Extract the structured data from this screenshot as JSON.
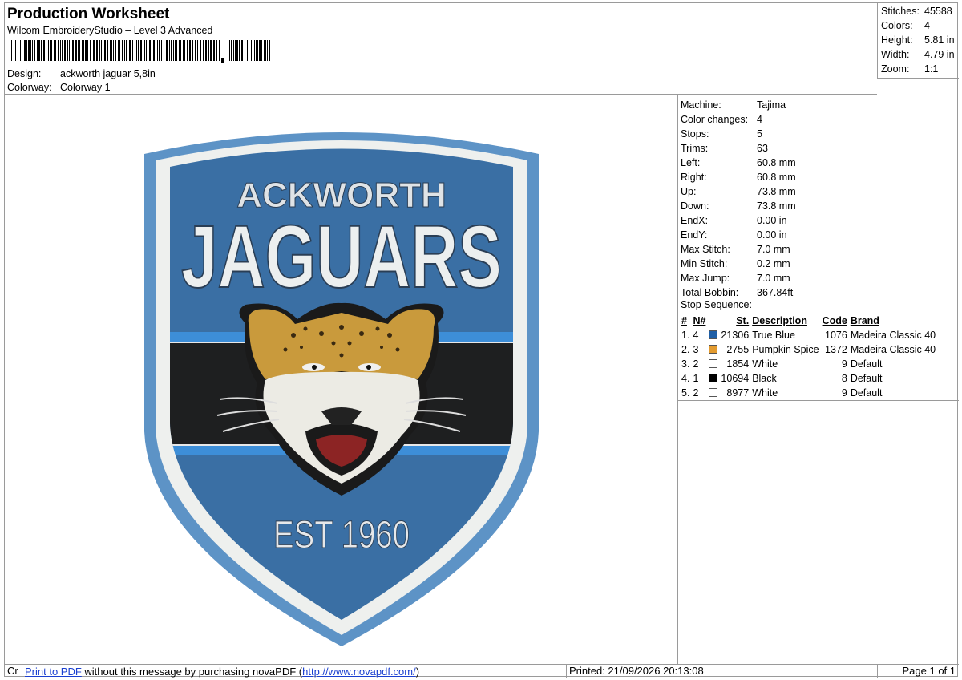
{
  "header": {
    "title": "Production Worksheet",
    "software": "Wilcom EmbroideryStudio – Level 3 Advanced",
    "design_label": "Design:",
    "design_value": "ackworth jaguar 5,8in",
    "colorway_label": "Colorway:",
    "colorway_value": "Colorway 1"
  },
  "summary": {
    "stitches_label": "Stitches:",
    "stitches": "45588",
    "colors_label": "Colors:",
    "colors": "4",
    "height_label": "Height:",
    "height": "5.81 in",
    "width_label": "Width:",
    "width": "4.79 in",
    "zoom_label": "Zoom:",
    "zoom": "1:1"
  },
  "specs": [
    {
      "k": "Machine:",
      "v": "Tajima"
    },
    {
      "k": "Color changes:",
      "v": "4"
    },
    {
      "k": "Stops:",
      "v": "5"
    },
    {
      "k": "Trims:",
      "v": "63"
    },
    {
      "k": "Left:",
      "v": "60.8 mm"
    },
    {
      "k": "Right:",
      "v": "60.8 mm"
    },
    {
      "k": "Up:",
      "v": "73.8 mm"
    },
    {
      "k": "Down:",
      "v": "73.8 mm"
    },
    {
      "k": "EndX:",
      "v": "0.00 in"
    },
    {
      "k": "EndY:",
      "v": "0.00 in"
    },
    {
      "k": "Max Stitch:",
      "v": "7.0 mm"
    },
    {
      "k": "Min Stitch:",
      "v": "0.2 mm"
    },
    {
      "k": "Max Jump:",
      "v": "7.0 mm"
    },
    {
      "k": "Total Bobbin:",
      "v": "367.84ft"
    }
  ],
  "stop_sequence": {
    "title": "Stop Sequence:",
    "headers": {
      "num": "#",
      "n": "N#",
      "st": "St.",
      "desc": "Description",
      "code": "Code",
      "brand": "Brand"
    },
    "rows": [
      {
        "num": "1.",
        "n": "4",
        "color": "#1f5fa6",
        "st": "21306",
        "desc": "True Blue",
        "code": "1076",
        "brand": "Madeira Classic 40"
      },
      {
        "num": "2.",
        "n": "3",
        "color": "#e39b2f",
        "st": "2755",
        "desc": "Pumpkin Spice",
        "code": "1372",
        "brand": "Madeira Classic 40"
      },
      {
        "num": "3.",
        "n": "2",
        "color": "#ffffff",
        "st": "1854",
        "desc": "White",
        "code": "9",
        "brand": "Default"
      },
      {
        "num": "4.",
        "n": "1",
        "color": "#000000",
        "st": "10694",
        "desc": "Black",
        "code": "8",
        "brand": "Default"
      },
      {
        "num": "5.",
        "n": "2",
        "color": "#ffffff",
        "st": "8977",
        "desc": "White",
        "code": "9",
        "brand": "Default"
      }
    ]
  },
  "patch": {
    "line1": "ACKWORTH",
    "line2": "JAGUARS",
    "line3": "EST 1960"
  },
  "footer": {
    "cr": "Cr",
    "link1": "Print to PDF",
    "msg": " without this message by purchasing novaPDF (",
    "link2": "http://www.novapdf.com/",
    "msg_end": ")",
    "printed": "Printed: 21/09/2026 20:13:08",
    "page": "Page 1 of 1"
  }
}
